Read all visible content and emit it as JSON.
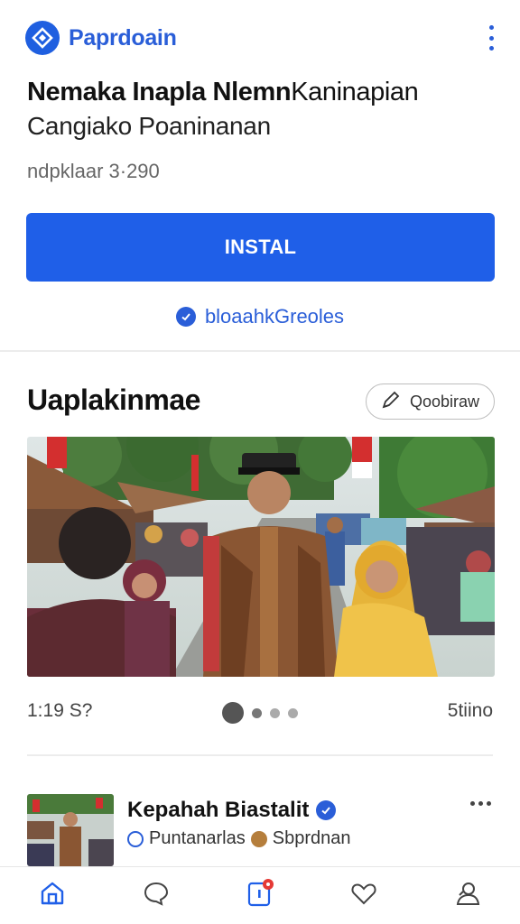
{
  "header": {
    "brand": "Paprdoain",
    "icons": {
      "logo": "diamond-logo-icon",
      "menu": "kebab-menu-icon"
    }
  },
  "app": {
    "title_bold": "Nemaka Inapla Nlemn",
    "title_rest": "Kaninapian",
    "subtitle": "Cangiako Poaninanan",
    "meta": "ndpklaar 3·290",
    "install_label": "INSTAL",
    "verified_link": "bloaahkGreoles"
  },
  "gallery": {
    "section_title": "Uaplakinmae",
    "share_label": "Qoobiraw",
    "left_info": "1:19 S?",
    "right_info": "5tiino"
  },
  "post": {
    "name": "Kepahah Biastalit",
    "sub_left": "Puntanarlas",
    "sub_right": "Sbprdnan"
  },
  "nav": {
    "items": [
      "home",
      "chat",
      "notifications",
      "likes",
      "profile"
    ],
    "notification_color": "#e53935"
  },
  "colors": {
    "accent": "#1f5fe8",
    "brand_text": "#2a5ed8"
  }
}
